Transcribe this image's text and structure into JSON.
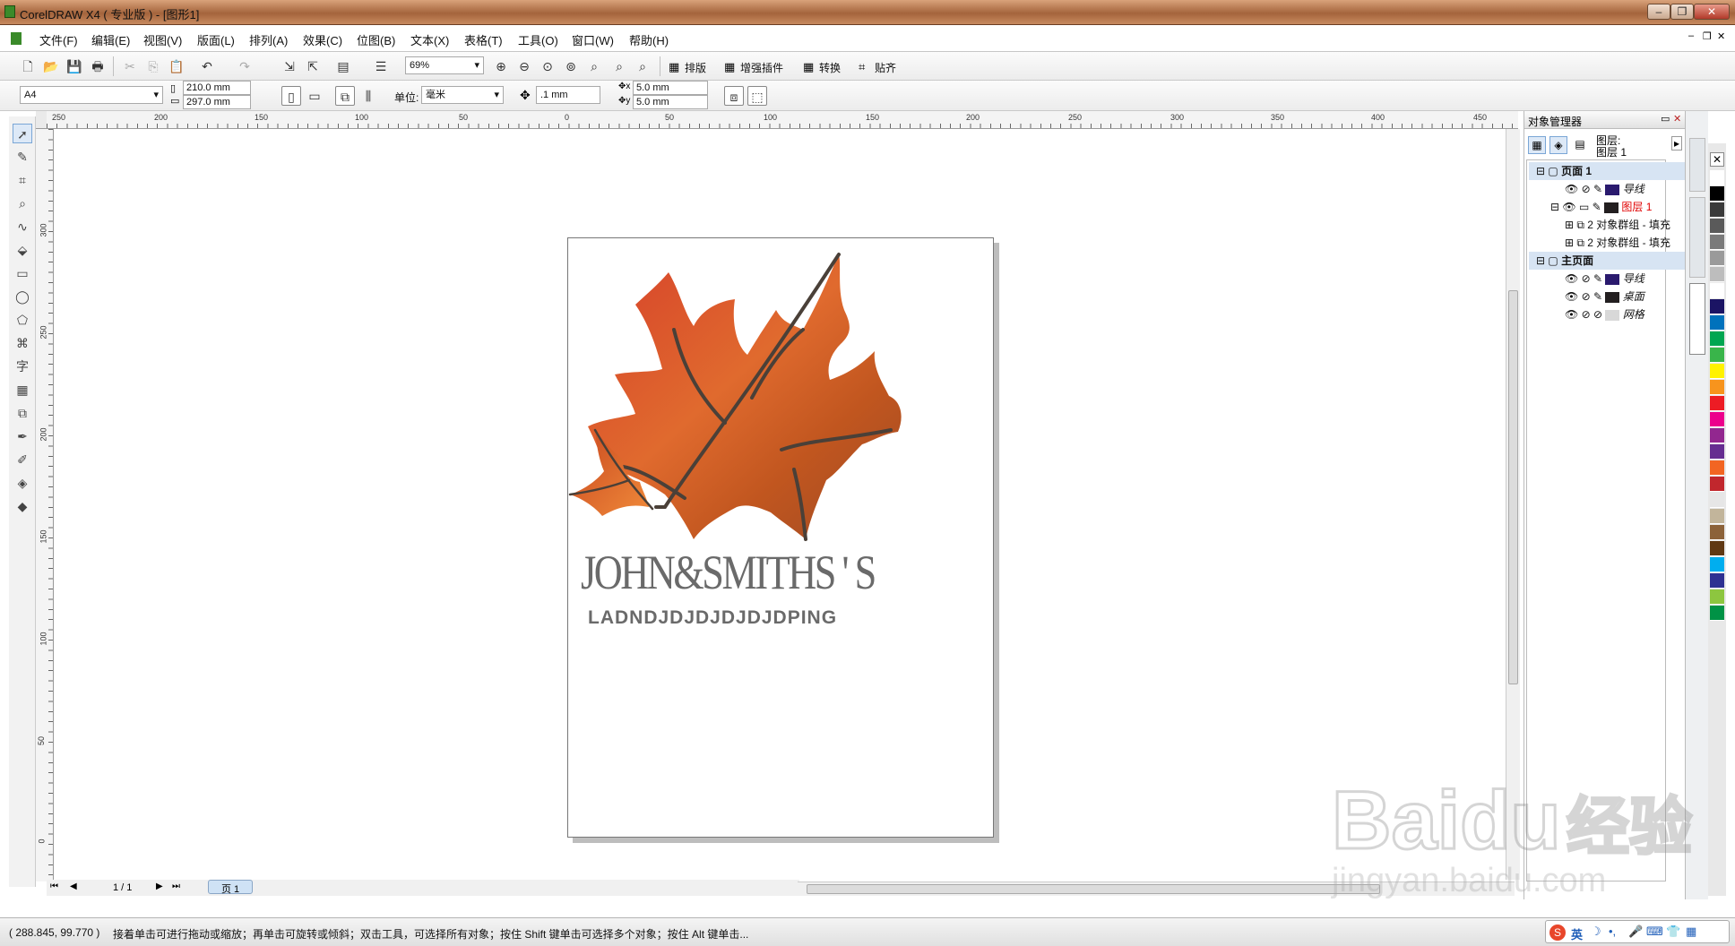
{
  "window": {
    "title": "CorelDRAW X4 ( 专业版 ) - [图形1]"
  },
  "menu": [
    "文件(F)",
    "编辑(E)",
    "视图(V)",
    "版面(L)",
    "排列(A)",
    "效果(C)",
    "位图(B)",
    "文本(X)",
    "表格(T)",
    "工具(O)",
    "窗口(W)",
    "帮助(H)"
  ],
  "toolbar": {
    "zoom": "69%",
    "btn_layout": "排版",
    "btn_plugin": "增强插件",
    "btn_convert": "转换",
    "btn_snap": "贴齐"
  },
  "property_bar": {
    "page_size": "A4",
    "width": "210.0 mm",
    "height": "297.0 mm",
    "unit_label": "单位:",
    "unit": "毫米",
    "nudge": ".1 mm",
    "dup_x": "5.0 mm",
    "dup_y": "5.0 mm"
  },
  "ruler": {
    "h_ticks": [
      "250",
      "200",
      "150",
      "100",
      "50",
      "0",
      "50",
      "100",
      "150",
      "200",
      "250",
      "300",
      "350",
      "400",
      "450"
    ],
    "v_ticks": [
      "300",
      "250",
      "200",
      "150",
      "100",
      "50",
      "0"
    ]
  },
  "page_nav": {
    "count": "1 / 1",
    "tab": "页 1"
  },
  "artwork": {
    "title": "JOHN&SMITHS ' S",
    "subtitle": "LADNDJDJDJDJDJDPING"
  },
  "object_manager": {
    "title": "对象管理器",
    "layer_header_1": "图层:",
    "layer_header_2": "图层 1",
    "rows": [
      {
        "label": "页面 1",
        "type": "page"
      },
      {
        "label": "导线",
        "type": "layer",
        "color": "#2a1a6e"
      },
      {
        "label": "图层 1",
        "type": "layer-active",
        "color": "#231f20"
      },
      {
        "label": "2 对象群组 - 填充",
        "type": "object"
      },
      {
        "label": "2 对象群组 - 填充",
        "type": "object"
      },
      {
        "label": "主页面",
        "type": "page"
      },
      {
        "label": "导线",
        "type": "layer",
        "color": "#2a1a6e"
      },
      {
        "label": "桌面",
        "type": "layer",
        "color": "#231f20"
      },
      {
        "label": "网格",
        "type": "layer",
        "color": "#d8d8d8"
      }
    ]
  },
  "palette": [
    "#ffffff",
    "#000000",
    "#3a3a3a",
    "#5a5a5a",
    "#7a7a7a",
    "#9a9a9a",
    "#bdbdbd",
    "#ffffff",
    "#1b1464",
    "#0072bc",
    "#00a651",
    "#39b54a",
    "#fff200",
    "#f7941d",
    "#ed1c24",
    "#ec008c",
    "#92278f",
    "#662d91",
    "#f26522",
    "#c1272d",
    "#e6e6e6",
    "#c2b59b",
    "#8c6239",
    "#603813",
    "#00aeef",
    "#2e3192",
    "#8dc63f",
    "#009245"
  ],
  "status": {
    "coords": "( 288.845, 99.770 )",
    "hint": "接着单击可进行拖动或缩放；再单击可旋转或倾斜；双击工具，可选择所有对象；按住 Shift 键单击可选择多个对象；按住 Alt 键单击..."
  },
  "watermark": {
    "brand": "Baidu",
    "cn": "经验",
    "url": "jingyan.baidu.com"
  },
  "ime": {
    "lang": "英"
  }
}
